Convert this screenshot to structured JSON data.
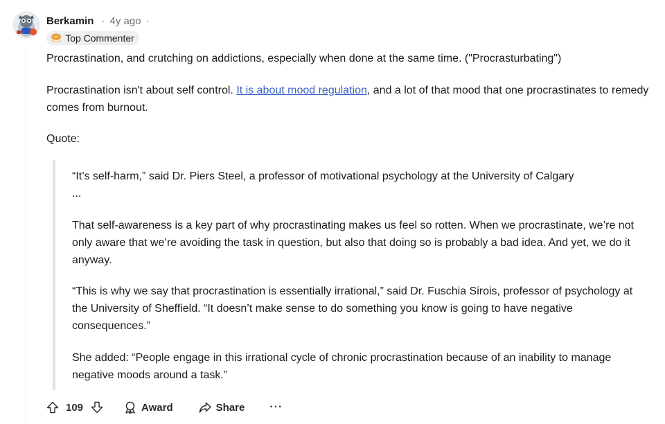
{
  "comment": {
    "author": "Berkamin",
    "age": "4y ago",
    "separator": "·",
    "flair_icon": "🥯",
    "flair_text": "Top Commenter",
    "paragraphs": {
      "p1": "Procrastination, and crutching on addictions, especially when done at the same time. (\"Procrasturbating\")",
      "p2_before_link": "Procrastination isn't about self control. ",
      "p2_link": "It is about mood regulation",
      "p2_after_link": ", and a lot of that mood that one procrastinates to remedy comes from burnout.",
      "p3": "Quote:"
    },
    "quote": {
      "q1_line1": "“It’s self-harm,” said Dr. Piers Steel, a professor of motivational psychology at the University of Calgary",
      "q1_line2": "...",
      "q2": "That self-awareness is a key part of why procrastinating makes us feel so rotten. When we procrastinate, we’re not only aware that we’re avoiding the task in question, but also that doing so is probably a bad idea. And yet, we do it anyway.",
      "q3": "“This is why we say that procrastination is essentially irrational,” said Dr. Fuschia Sirois, professor of psychology at the University of Sheffield. “It doesn’t make sense to do something you know is going to have negative consequences.”",
      "q4": "She added: “People engage in this irrational cycle of chronic procrastination because of an inability to manage negative moods around a task.”"
    }
  },
  "actions": {
    "score": "109",
    "award_label": "Award",
    "share_label": "Share",
    "more_label": "···"
  },
  "icons": {
    "upvote": "upvote-icon",
    "downvote": "downvote-icon",
    "award": "award-icon",
    "share": "share-icon",
    "avatar": "avatar-image"
  },
  "colors": {
    "link": "#3b63c7",
    "meta": "#6b6f73",
    "flair_bg": "#edeff1",
    "quote_border": "#dfe1e3"
  }
}
